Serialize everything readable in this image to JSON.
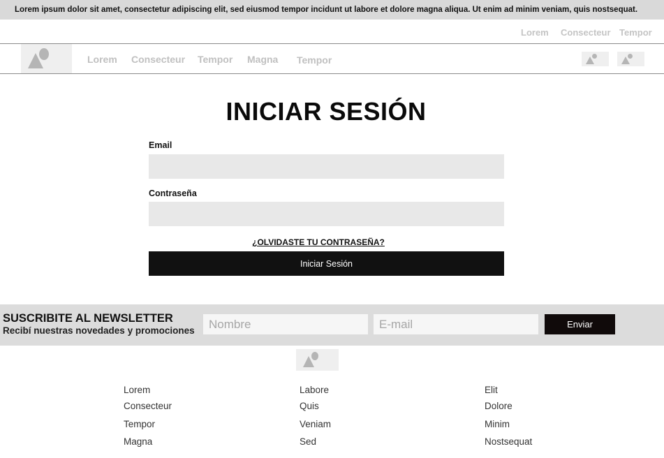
{
  "announcement": "Lorem ipsum dolor sit amet, consectetur adipiscing elit, sed eiusmod tempor incidunt ut labore et dolore magna aliqua. Ut enim ad minim veniam, quis nostsequat.",
  "utility_nav": [
    "Lorem",
    "Consecteur",
    "Tempor"
  ],
  "main_nav": {
    "logo_icon": "image-placeholder-icon",
    "links": [
      "Lorem",
      "Consecteur",
      "Tempor",
      "Magna",
      "Tempor"
    ],
    "icon_buttons": [
      "image-placeholder-icon",
      "image-placeholder-icon"
    ]
  },
  "login": {
    "title": "INICIAR SESIÓN",
    "email_label": "Email",
    "email_value": "",
    "password_label": "Contraseña",
    "password_value": "",
    "forgot_link": "¿OLVIDASTE TU CONTRASEÑA?",
    "submit_label": "Iniciar Sesión"
  },
  "newsletter": {
    "title": "SUSCRIBITE AL NEWSLETTER",
    "subtitle": "Recibí nuestras novedades y promociones",
    "name_placeholder": "Nombre",
    "email_placeholder": "E-mail",
    "submit_label": "Enviar"
  },
  "footer": {
    "logo_icon": "image-placeholder-icon",
    "columns": [
      [
        "Lorem",
        "Consecteur",
        "Tempor",
        "Magna"
      ],
      [
        "Labore",
        "Quis",
        "Veniam",
        "Sed"
      ],
      [
        "Elit",
        "Dolore",
        "Minim",
        "Nostsequat"
      ]
    ]
  },
  "colors": {
    "announcement_bg": "#d9d9d9",
    "nav_text": "#c0c0c0",
    "input_bg": "#e8e8e8",
    "primary_button": "#111111",
    "newsletter_bg": "#dcdcdc"
  }
}
